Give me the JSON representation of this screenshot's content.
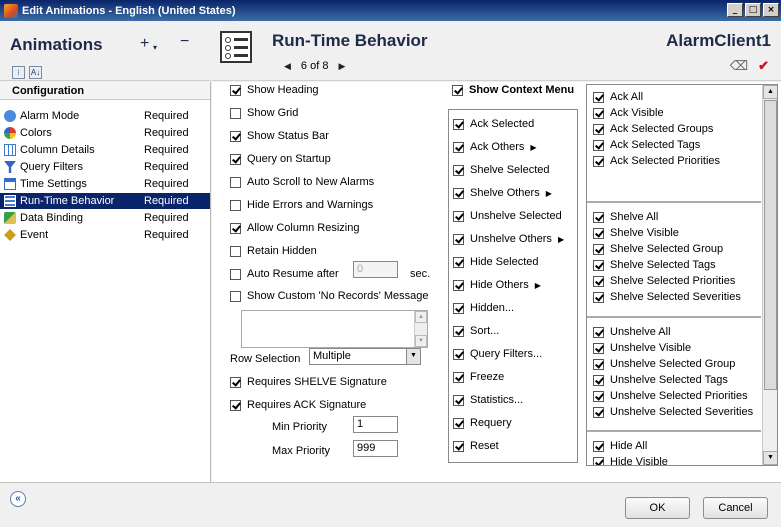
{
  "window": {
    "title": "Edit Animations - English (United States)",
    "buttons": [
      "_",
      "□",
      "×"
    ]
  },
  "left_header": {
    "title": "Animations",
    "add": "+",
    "dropdown": "▾",
    "remove": "−",
    "sort_icons": [
      "⁝",
      "A↓"
    ]
  },
  "right_header": {
    "title": "Run-Time Behavior",
    "prev": "◀",
    "page": "6 of 8",
    "next": "▶",
    "object_name": "AlarmClient1",
    "eraser": "⌫",
    "apply": "✔"
  },
  "config": {
    "header": "Configuration",
    "items": [
      {
        "name": "Alarm Mode",
        "status": "Required",
        "icon_color": "#4a8ad8"
      },
      {
        "name": "Colors",
        "status": "Required",
        "icon_color": "#e23a2a"
      },
      {
        "name": "Column Details",
        "status": "Required",
        "icon_color": "#3a7ad0"
      },
      {
        "name": "Query Filters",
        "status": "Required",
        "icon_color": "#3366cc"
      },
      {
        "name": "Time Settings",
        "status": "Required",
        "icon_color": "#3a6acc"
      },
      {
        "name": "Run-Time Behavior",
        "status": "Required",
        "icon_color": "#4a7acc"
      },
      {
        "name": "Data Binding",
        "status": "Required",
        "icon_color": "#3aa04a"
      },
      {
        "name": "Event",
        "status": "Required",
        "icon_color": "#c8a020"
      }
    ]
  },
  "options": {
    "show_heading": "Show Heading",
    "show_grid": "Show Grid",
    "show_status_bar": "Show Status Bar",
    "query_on_startup": "Query on Startup",
    "auto_scroll": "Auto Scroll to New Alarms",
    "hide_errors": "Hide Errors and Warnings",
    "allow_resizing": "Allow Column Resizing",
    "retain_hidden": "Retain Hidden",
    "auto_resume": "Auto Resume after",
    "auto_resume_value": "0",
    "sec": "sec.",
    "custom_no_records": "Show Custom 'No Records' Message",
    "row_selection_label": "Row Selection",
    "row_selection_value": "Multiple",
    "requires_shelve": "Requires SHELVE Signature",
    "requires_ack": "Requires ACK Signature",
    "min_priority_label": "Min Priority",
    "min_priority_value": "1",
    "max_priority_label": "Max Priority",
    "max_priority_value": "999"
  },
  "context_menu": {
    "header": "Show Context Menu",
    "items": [
      {
        "label": "Ack Selected",
        "sub": ""
      },
      {
        "label": "Ack Others",
        "sub": "▶"
      },
      {
        "label": "Shelve Selected",
        "sub": ""
      },
      {
        "label": "Shelve Others",
        "sub": "▶"
      },
      {
        "label": "Unshelve Selected",
        "sub": ""
      },
      {
        "label": "Unshelve Others",
        "sub": "▶"
      },
      {
        "label": "Hide Selected",
        "sub": ""
      },
      {
        "label": "Hide Others",
        "sub": "▶"
      },
      {
        "label": "Hidden...",
        "sub": ""
      },
      {
        "label": "Sort...",
        "sub": ""
      },
      {
        "label": "Query Filters...",
        "sub": ""
      },
      {
        "label": "Freeze",
        "sub": ""
      },
      {
        "label": "Statistics...",
        "sub": ""
      },
      {
        "label": "Requery",
        "sub": ""
      },
      {
        "label": "Reset",
        "sub": ""
      }
    ]
  },
  "sub_groups": {
    "ack": [
      "Ack All",
      "Ack Visible",
      "Ack Selected Groups",
      "Ack Selected Tags",
      "Ack Selected Priorities"
    ],
    "shelve": [
      "Shelve All",
      "Shelve Visible",
      "Shelve Selected Group",
      "Shelve Selected Tags",
      "Shelve Selected Priorities",
      "Shelve Selected Severities"
    ],
    "unshelve": [
      "Unshelve All",
      "Unshelve Visible",
      "Unshelve Selected Group",
      "Unshelve Selected Tags",
      "Unshelve Selected Priorities",
      "Unshelve Selected Severities"
    ],
    "hide": [
      "Hide All",
      "Hide Visible"
    ]
  },
  "footer": {
    "collapse": "«",
    "ok": "OK",
    "cancel": "Cancel"
  },
  "scroll": {
    "up": "▲",
    "down": "▼"
  }
}
